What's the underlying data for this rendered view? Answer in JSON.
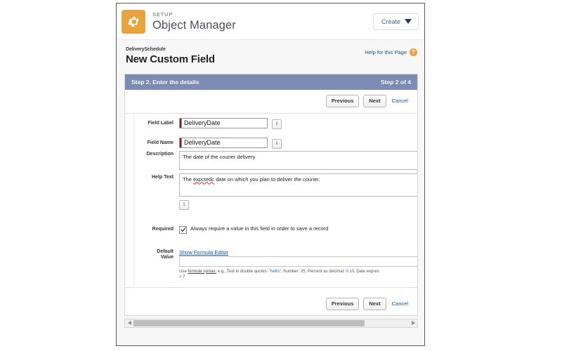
{
  "setup_header": {
    "gear_icon": "gear-icon",
    "eyebrow": "SETUP",
    "title": "Object Manager",
    "create_label": "Create",
    "caret_icon": "chevron-down-icon"
  },
  "page": {
    "breadcrumb": "DeliverySchedule",
    "title": "New Custom Field",
    "help_link": "Help for this Page",
    "help_badge": "?"
  },
  "wizard": {
    "step_title": "Step 2. Enter the details",
    "step_counter": "Step 2 of 4",
    "previous_label": "Previous",
    "next_label": "Next",
    "cancel_label": "Cancel"
  },
  "form": {
    "field_label": {
      "label": "Field Label",
      "value": "DeliveryDate",
      "required": true,
      "info_icon": "info-icon"
    },
    "field_name": {
      "label": "Field Name",
      "value": "DeliveryDate",
      "required": true,
      "info_icon": "info-icon"
    },
    "description": {
      "label": "Description",
      "value": "The date  of the courier delivery"
    },
    "help_text": {
      "label": "Help Text",
      "value_before": "The ",
      "value_misspelled": "expctedc",
      "value_after": " date on which you plan to deliver the courier.",
      "info_icon": "info-icon"
    },
    "required": {
      "label": "Required",
      "checkbox_label": "Always require a value in this field in order to save a record",
      "checked": true
    },
    "default_value": {
      "label_line1": "Default",
      "label_line2": "Value",
      "formula_editor_link": "Show Formula Editor",
      "value": "",
      "syntax_hint_1": "Use ",
      "syntax_hint_link": "formula syntax:",
      "syntax_hint_2": " e.g., Text in double quotes: ",
      "syntax_hint_lit1": "\"hello\"",
      "syntax_hint_3": ", Number: ",
      "syntax_hint_lit2": "25",
      "syntax_hint_4": ", Percent as decimal: ",
      "syntax_hint_lit3": "0.10",
      "syntax_hint_5": ", Date expres",
      "syntax_hint_line2": "+ 7"
    }
  },
  "footer": {
    "previous_label": "Previous",
    "next_label": "Next",
    "cancel_label": "Cancel"
  },
  "scrollbar": {
    "left_arrow_icon": "triangle-left-icon",
    "right_arrow_icon": "triangle-right-icon"
  },
  "colors": {
    "gear_tile": "#e8a33d",
    "step_bar": "#7d8cb5",
    "link": "#15518f",
    "required_mark": "#8c1b1b",
    "misspelled_underline": "#c62828"
  }
}
